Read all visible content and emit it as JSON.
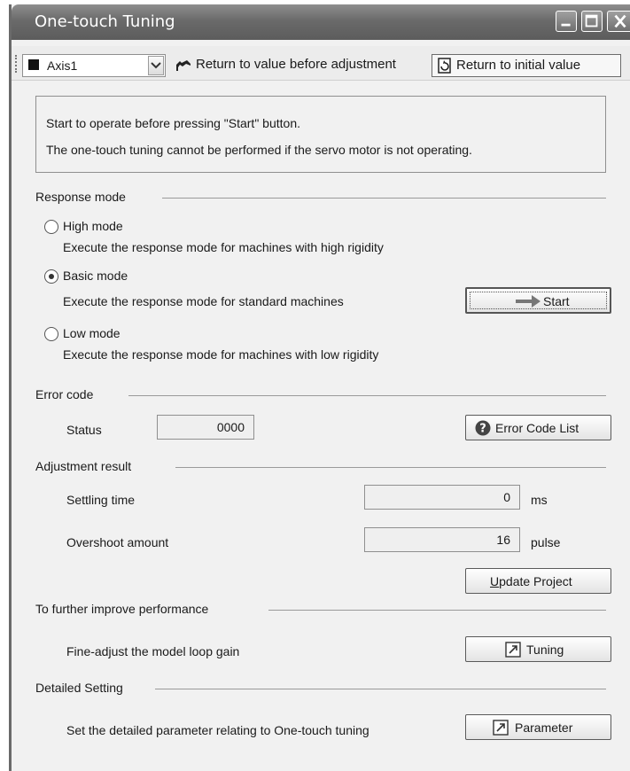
{
  "window": {
    "title": "One-touch Tuning"
  },
  "toolbar": {
    "axis_value": "Axis1",
    "return_before_label": "Return to value before adjustment",
    "return_initial_label": "Return to initial value"
  },
  "info": {
    "line1": "Start to operate before pressing \"Start\" button.",
    "line2": "The one-touch tuning cannot be performed if the servo motor is not operating."
  },
  "response_mode": {
    "heading": "Response mode",
    "selected": "basic",
    "options": [
      {
        "label": "High mode",
        "desc": "Execute the response mode for machines with high rigidity"
      },
      {
        "label": "Basic mode",
        "desc": "Execute the response mode for standard machines"
      },
      {
        "label": "Low mode",
        "desc": "Execute the response mode for machines with low rigidity"
      }
    ],
    "start_label": "Start"
  },
  "error_code": {
    "heading": "Error code",
    "status_label": "Status",
    "status_value": "0000",
    "list_button": "Error Code List"
  },
  "adjustment": {
    "heading": "Adjustment result",
    "settling_label": "Settling time",
    "settling_value": "0",
    "settling_unit": "ms",
    "overshoot_label": "Overshoot amount",
    "overshoot_value": "16",
    "overshoot_unit": "pulse",
    "update_first": "U",
    "update_rest": "pdate Project"
  },
  "improve": {
    "heading": "To further improve performance",
    "label": "Fine-adjust the model loop gain",
    "button": "Tuning"
  },
  "detailed": {
    "heading": "Detailed Setting",
    "label": "Set the detailed parameter relating to One-touch tuning",
    "button": "Parameter"
  },
  "icons": {
    "minimize": "minimize-icon",
    "maximize": "maximize-icon",
    "close": "close-icon",
    "return": "return-arrow-icon",
    "initial": "reset-document-icon",
    "help": "help-icon",
    "open": "open-window-arrow-icon",
    "play": "play-arrow-icon"
  }
}
